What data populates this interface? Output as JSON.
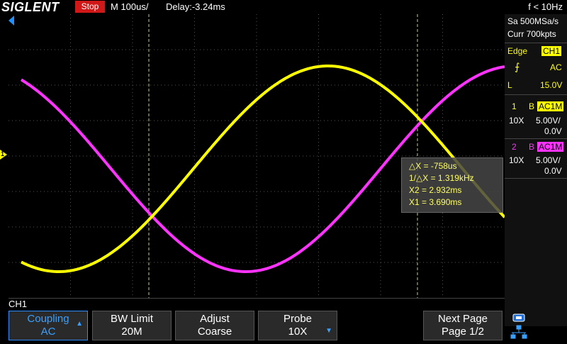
{
  "topbar": {
    "logo": "SIGLENT",
    "run_state": "Stop",
    "timebase": "M 100us/",
    "delay": "Delay:-3.24ms",
    "frequency": "f < 10Hz"
  },
  "acquisition": {
    "sample_rate": "Sa 500MSa/s",
    "memory": "Curr 700kpts"
  },
  "trigger": {
    "label": "Edge",
    "source": "CH1",
    "coupling": "AC",
    "level_marker": "L",
    "level": "15.0V"
  },
  "channel1": {
    "number": "1",
    "bw": "B",
    "coupling": "AC1M",
    "probe": "10X",
    "scale": "5.00V/",
    "offset": "0.0V",
    "marker": "1"
  },
  "channel2": {
    "number": "2",
    "bw": "B",
    "coupling": "AC1M",
    "probe": "10X",
    "scale": "5.00V/",
    "offset": "0.0V"
  },
  "measurements": {
    "dx": "△X = -758us",
    "inv_dx": "1/△X = 1.319kHz",
    "x2": "X2 = 2.932ms",
    "x1": "X1 = 3.690ms"
  },
  "menu": {
    "channel_label": "CH1",
    "buttons": [
      {
        "line1": "Coupling",
        "line2": "AC"
      },
      {
        "line1": "BW Limit",
        "line2": "20M"
      },
      {
        "line1": "Adjust",
        "line2": "Coarse"
      },
      {
        "line1": "Probe",
        "line2": "10X"
      },
      {
        "line1": "Next Page",
        "line2": "Page 1/2"
      }
    ]
  },
  "colors": {
    "ch1": "#ffff00",
    "ch2": "#ff33ff",
    "accent": "#39a0ff",
    "stop": "#d01818"
  }
}
